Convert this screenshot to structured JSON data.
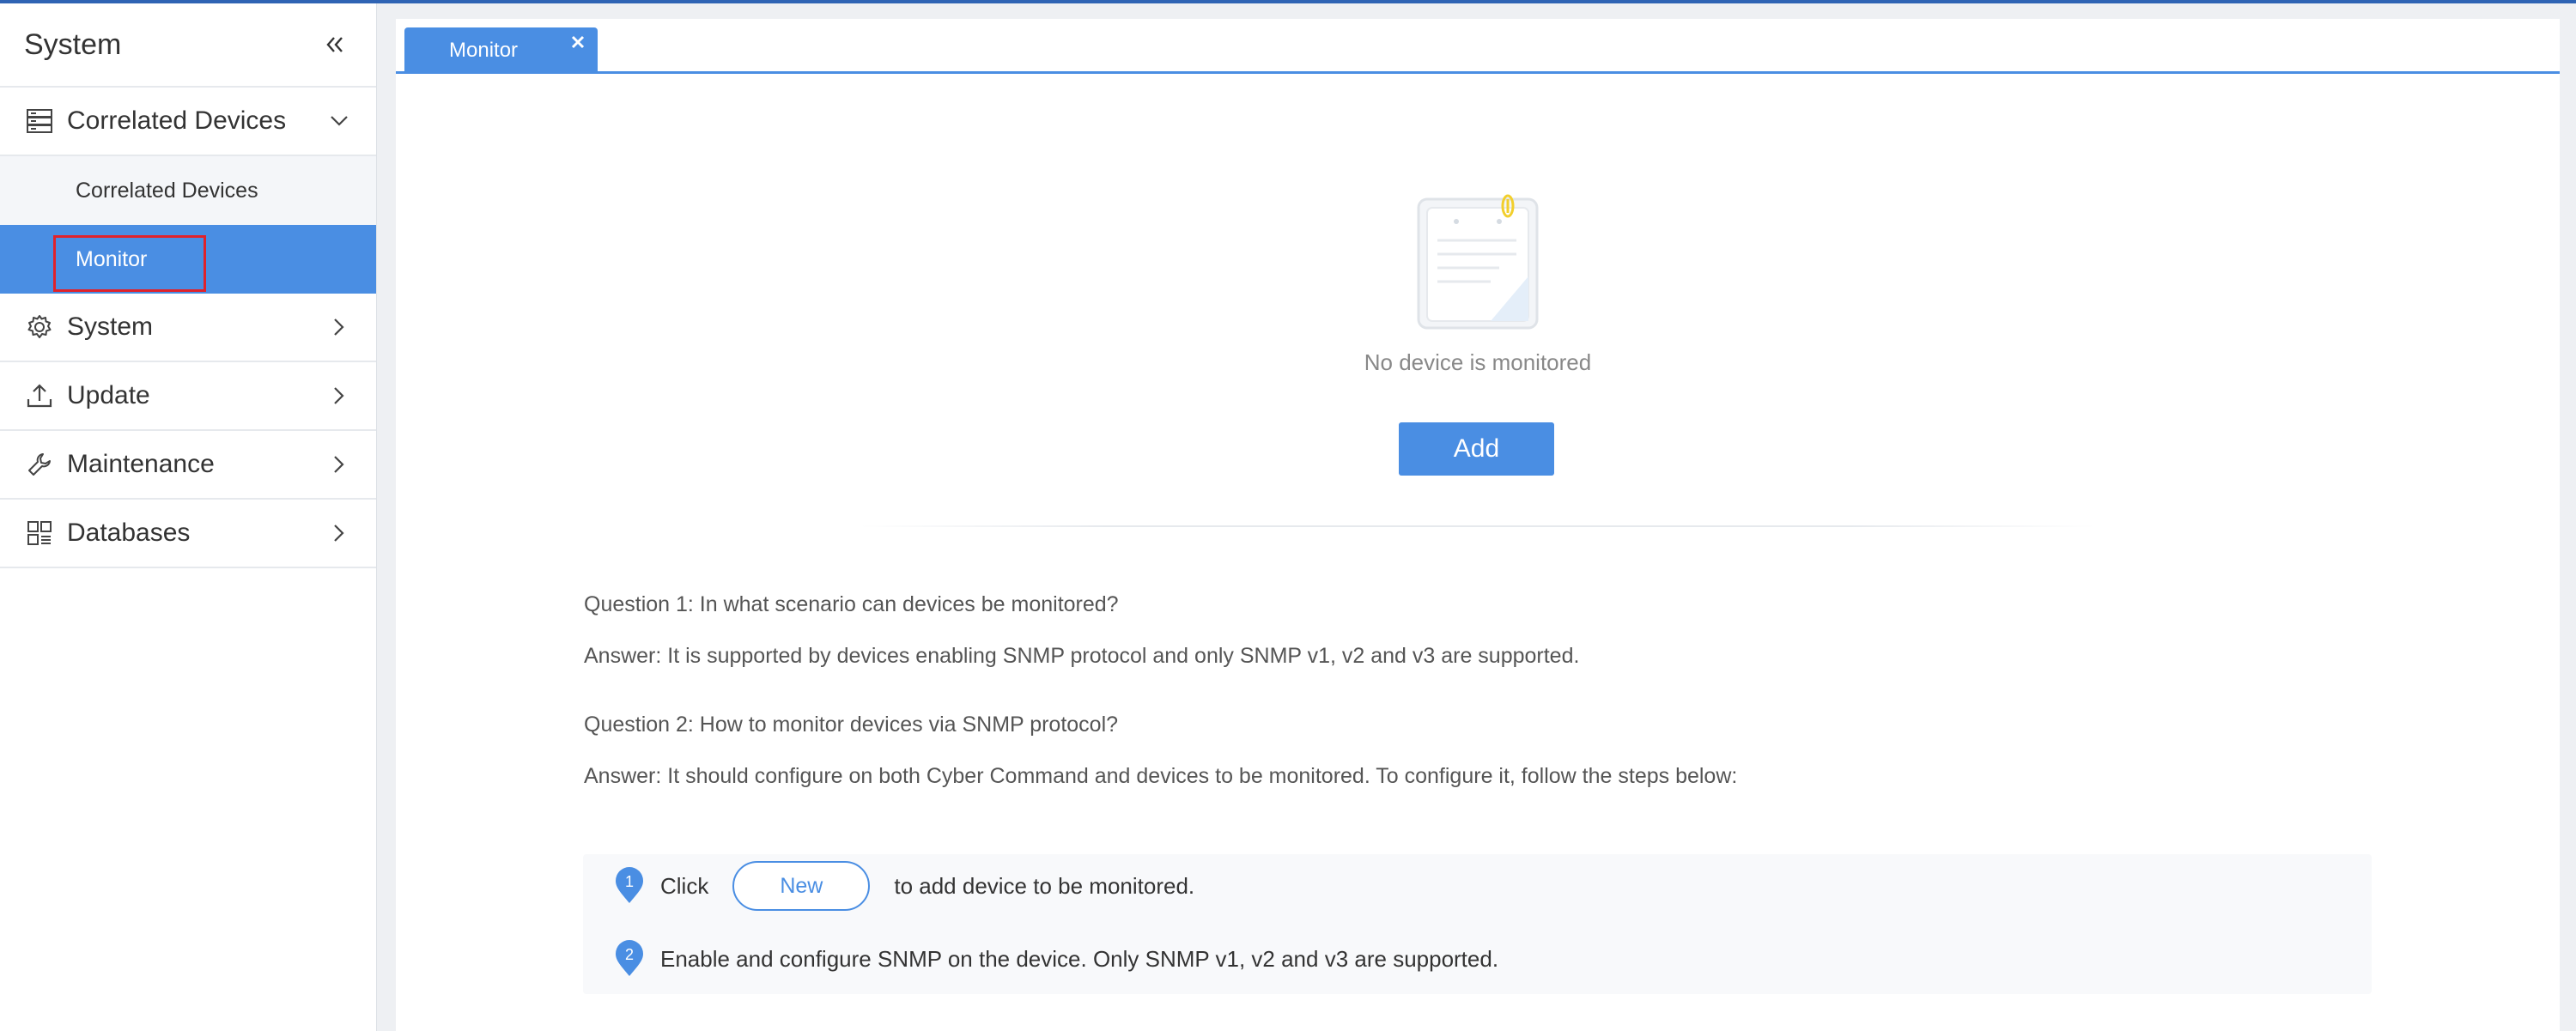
{
  "sidebar": {
    "title": "System",
    "menu": [
      {
        "label": "Correlated Devices",
        "icon": "server-icon",
        "expanded": true
      },
      {
        "label": "System",
        "icon": "gear-icon"
      },
      {
        "label": "Update",
        "icon": "upload-icon"
      },
      {
        "label": "Maintenance",
        "icon": "wrench-icon"
      },
      {
        "label": "Databases",
        "icon": "grid-icon"
      }
    ],
    "submenu": [
      {
        "label": "Correlated Devices"
      },
      {
        "label": "Monitor",
        "active": true
      }
    ]
  },
  "tabs": [
    {
      "label": "Monitor",
      "close_glyph": "×"
    }
  ],
  "empty_state": {
    "message": "No device is monitored",
    "add_label": "Add"
  },
  "faq": [
    {
      "question": "Question 1: In what scenario can devices be monitored?",
      "answer": "Answer: It is supported by devices enabling SNMP protocol and only SNMP v1, v2 and v3 are supported."
    },
    {
      "question": "Question 2: How to monitor devices via SNMP protocol?",
      "answer": "Answer: It should configure on both Cyber Command and devices to be monitored. To configure it, follow the steps below:"
    }
  ],
  "steps": {
    "step1": {
      "number": "1",
      "before": "Click",
      "button": "New",
      "after": "to add device to be monitored."
    },
    "step2": {
      "number": "2",
      "text": "Enable and configure SNMP on the device. Only SNMP v1, v2 and v3 are supported."
    }
  },
  "colors": {
    "accent": "#4a8ee3",
    "highlight_border": "#e0222b",
    "topbar": "#2f64b4"
  }
}
